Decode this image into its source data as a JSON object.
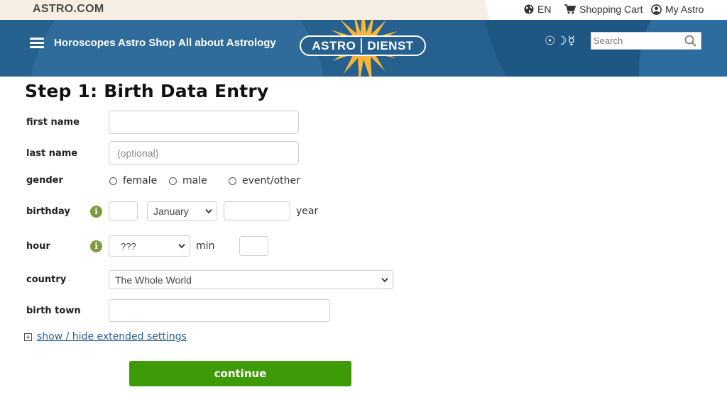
{
  "topbar": {
    "brand": "ASTRO.COM",
    "language": "EN",
    "cart": "Shopping Cart",
    "account": "My Astro"
  },
  "nav": {
    "links": [
      "Horoscopes",
      "Astro Shop",
      "All about Astrology"
    ],
    "logo": {
      "left": "ASTRO",
      "right": "DIENST"
    },
    "planet_symbols": "☉☽☿",
    "search_placeholder": "Search"
  },
  "form": {
    "title": "Step 1: Birth Data Entry",
    "first_name": {
      "label": "first name",
      "value": "",
      "placeholder": ""
    },
    "last_name": {
      "label": "last name",
      "value": "",
      "placeholder": "(optional)"
    },
    "gender": {
      "label": "gender",
      "options": [
        "female",
        "male",
        "event/other"
      ]
    },
    "birthday": {
      "label": "birthday",
      "day": "",
      "month": "January",
      "year_value": "",
      "year_label": "year"
    },
    "hour": {
      "label": "hour",
      "hour_value": "???",
      "min_label": "min",
      "min_value": ""
    },
    "country": {
      "label": "country",
      "value": "The Whole World"
    },
    "birth_town": {
      "label": "birth town",
      "value": ""
    },
    "extended_link": "show / hide extended settings",
    "continue_label": "continue"
  },
  "colors": {
    "header_blue": "#26608f",
    "continue_green": "#3f9a07",
    "info_green": "#7d9a3d",
    "logo_sun": "#f5b63a"
  },
  "icons": [
    "globe-icon",
    "cart-icon",
    "user-icon",
    "hamburger-icon",
    "search-icon",
    "info-icon",
    "chevron-down-icon",
    "expand-icon"
  ]
}
